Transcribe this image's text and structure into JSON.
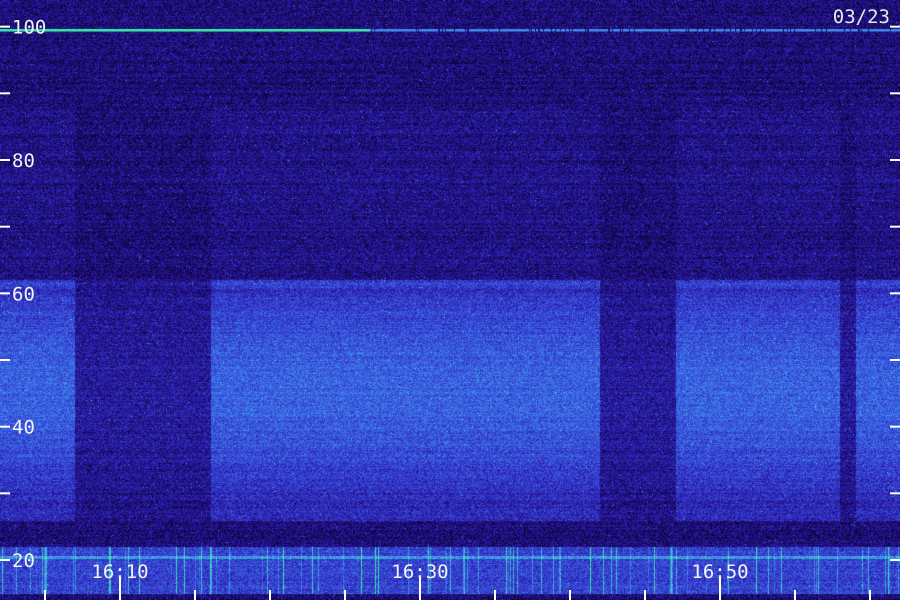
{
  "chart_data": {
    "type": "heatmap",
    "title": "",
    "date_label": "03/23",
    "xlabel": "",
    "ylabel": "",
    "y_ticks": [
      {
        "value": 100,
        "label": "100"
      },
      {
        "value": 80,
        "label": "80"
      },
      {
        "value": 60,
        "label": "60"
      },
      {
        "value": 40,
        "label": "40"
      },
      {
        "value": 20,
        "label": "20"
      }
    ],
    "y_minor_ticks": [
      90,
      70,
      50,
      30
    ],
    "ylim": [
      14,
      104
    ],
    "x_labels": [
      {
        "time": "16:10",
        "label": "16:10"
      },
      {
        "time": "16:30",
        "label": "16:30"
      },
      {
        "time": "16:50",
        "label": "16:50"
      }
    ],
    "x_minor_ticks": [
      "16:05",
      "16:15",
      "16:20",
      "16:25",
      "16:35",
      "16:40",
      "16:45",
      "16:55",
      "17:00"
    ],
    "x_range": [
      "16:02",
      "17:02"
    ],
    "colormap": [
      "#0c0233",
      "#2a18a8",
      "#3a55e0",
      "#3fa0f0",
      "#3ef0a0"
    ],
    "background_color": "#120640",
    "tick_color": "#ffffff",
    "label_color": "#f2f2f2",
    "quiet_intervals": [
      [
        "16:07",
        "16:16"
      ],
      [
        "16:42",
        "16:47"
      ],
      [
        "16:58",
        "16:59"
      ]
    ],
    "interference_line_value": 99.5,
    "low_band_range": [
      15,
      22
    ],
    "mid_band_range": [
      26,
      62
    ]
  }
}
